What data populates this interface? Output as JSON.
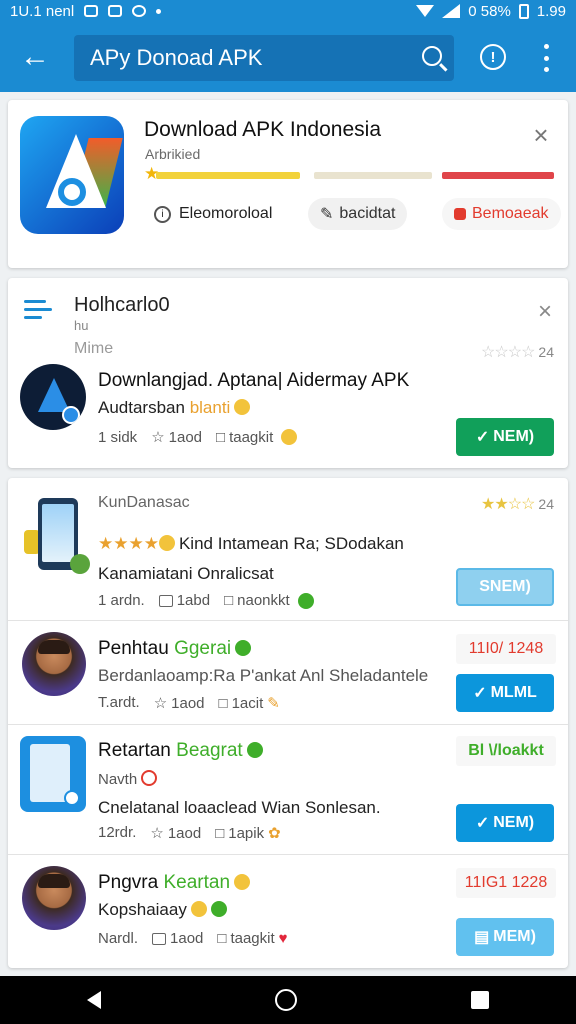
{
  "status_bar": {
    "time_left": "1U.1 nenl",
    "battery_text": "0 58%",
    "clock": "1.99"
  },
  "search": {
    "placeholder": "APy Donoad APK"
  },
  "card1": {
    "title": "Download APK Indonesia",
    "subtitle": "Arbrikied",
    "rating_colors": [
      "#f2d23b",
      "#e9e3cf",
      "#e0454a"
    ],
    "chip1": "Eleomoroloal",
    "chip2": "bacidtat",
    "chip3": "Bemoaeak"
  },
  "card2": {
    "header_title": "Holhcarlo0",
    "header_sub1": "hu",
    "header_sub2": "Mime",
    "rating_count": "24",
    "app_title": "Downlangjad. Aptana| Aidermay APK",
    "app_desc_start": "Audtarsban ",
    "app_desc_highlight": "blanti",
    "meta1": "1 sidk",
    "meta2": "1aod",
    "meta3": "taagkit",
    "button_label": "NEM)"
  },
  "card3": {
    "rows": [
      {
        "header": "KunDanasac",
        "rating_count": "24",
        "title": "Kind Intamean Ra; SDodakan",
        "desc": "Kanamiatani Onralicsat",
        "meta1": "1 ardn.",
        "meta2": "1abd",
        "meta3": "naonkkt",
        "button": "SNEM)"
      },
      {
        "title_start": "Penhtau ",
        "title_highlight": "Ggerai",
        "desc": "Berdanlaoamp:Ra P'ankat Anl Sheladantele",
        "meta1": "T.ardt.",
        "meta2": "1aod",
        "meta3": "1acit",
        "score": "11I0/ 1248",
        "button": "MLML"
      },
      {
        "title_start": "Retartan ",
        "title_highlight": "Beagrat",
        "subtitle": "Navth",
        "desc": "Cnelatanal loaaclead Wian Sonlesan.",
        "meta1": "12rdr.",
        "meta2": "1aod",
        "meta3": "1apik",
        "score": "Bl \\/loakkt",
        "button": "NEM)"
      },
      {
        "title_start": "Pngvra ",
        "title_highlight": "Keartan",
        "desc": "Kopshaiaay",
        "meta1": "Nardl.",
        "meta2": "1aod",
        "meta3": "taagkit",
        "score": "11IG1 1228",
        "button": "MEM)"
      }
    ]
  }
}
